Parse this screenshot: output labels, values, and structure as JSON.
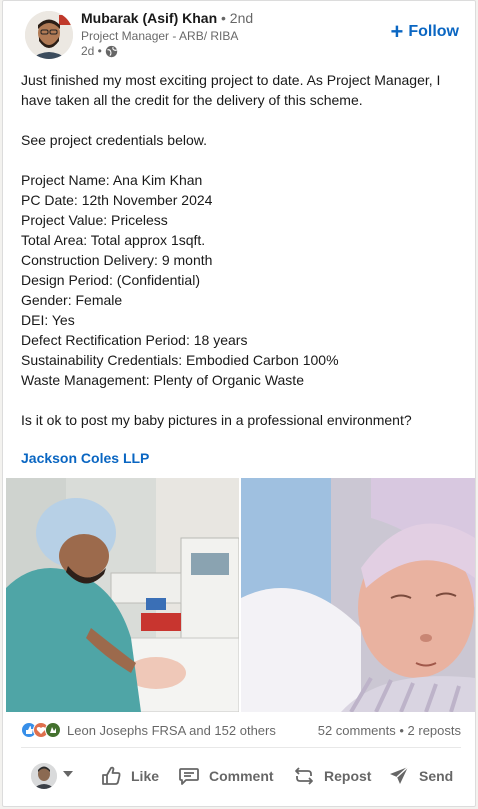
{
  "author": {
    "name": "Mubarak (Asif) Khan",
    "degree": "• 2nd",
    "headline": "Project Manager - ARB/ RIBA",
    "time": "2d •"
  },
  "follow": {
    "label": "Follow"
  },
  "post": {
    "lines": [
      "Just finished my most exciting project to date. As Project Manager, I",
      "have taken all the credit for the delivery of this scheme.",
      "",
      "See project credentials below.",
      "",
      "Project Name: Ana Kim Khan",
      "PC Date: 12th November 2024",
      "Project Value: Priceless",
      "Total Area: Total approx 1sqft.",
      "Construction Delivery: 9 month",
      "Design Period: (Confidential)",
      "Gender: Female",
      "DEI: Yes",
      "Defect Rectification Period: 18 years",
      "Sustainability Credentials: Embodied Carbon 100%",
      "Waste Management: Plenty of Organic Waste",
      "",
      "Is it ok to post my baby pictures in a professional environment?"
    ],
    "mention": "Jackson Coles LLP"
  },
  "social": {
    "reactions_text": "Leon Josephs FRSA and 152 others",
    "comments_reposts": "52 comments • 2 reposts",
    "reaction_icons": [
      "like-icon",
      "love-icon",
      "celebrate-icon"
    ]
  },
  "actions": {
    "like": "Like",
    "comment": "Comment",
    "repost": "Repost",
    "send": "Send"
  },
  "colors": {
    "link_blue": "#0a66c2",
    "text_secondary": "rgba(0,0,0,0.6)",
    "background": "#ffffff"
  }
}
